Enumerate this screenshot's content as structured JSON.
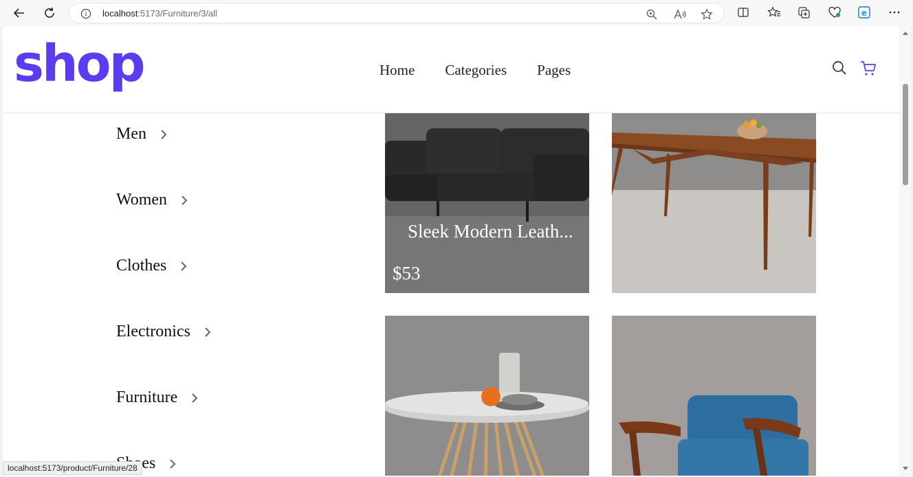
{
  "browser": {
    "url_host": "localhost",
    "url_rest": ":5173/Furniture/3/all",
    "status_url": "localhost:5173/product/Furniture/28"
  },
  "header": {
    "logo": "shop",
    "nav": [
      "Home",
      "Categories",
      "Pages"
    ],
    "accent_color": "#5b3cf0"
  },
  "sidebar": {
    "categories": [
      "Men",
      "Women",
      "Clothes",
      "Electronics",
      "Furniture",
      "Shoes"
    ]
  },
  "products": [
    {
      "title": "Sleek Modern Leath...",
      "price": "$53",
      "image": "black-leather-sofa"
    },
    {
      "image": "wooden-dining-table"
    },
    {
      "image": "round-marble-table"
    },
    {
      "image": "blue-armchair"
    }
  ]
}
